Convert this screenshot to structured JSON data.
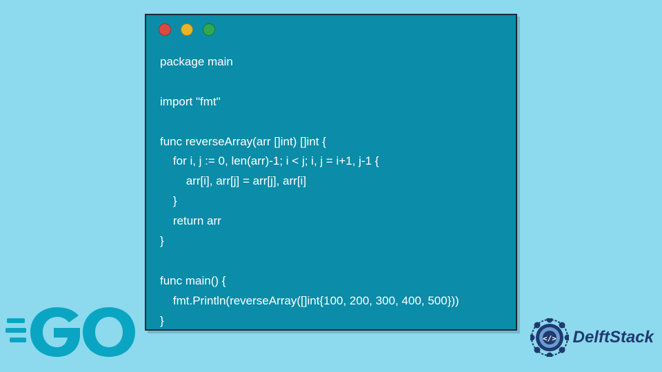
{
  "window": {
    "dots": [
      "red",
      "yellow",
      "green"
    ]
  },
  "code": {
    "lines": [
      "package main",
      "",
      "import \"fmt\"",
      "",
      "func reverseArray(arr []int) []int {",
      "    for i, j := 0, len(arr)-1; i < j; i, j = i+1, j-1 {",
      "        arr[i], arr[j] = arr[j], arr[i]",
      "    }",
      "    return arr",
      "}",
      "",
      "func main() {",
      "    fmt.Println(reverseArray([]int{100, 200, 300, 400, 500}))",
      "}"
    ]
  },
  "logos": {
    "go_label": "GO",
    "delft_label": "DelftStack"
  },
  "colors": {
    "bg": "#8dd9ed",
    "window_bg": "#0b8ca8",
    "code_text": "#ffffff",
    "go_blue": "#0aa5c2",
    "delft_blue": "#1e3a6e"
  }
}
